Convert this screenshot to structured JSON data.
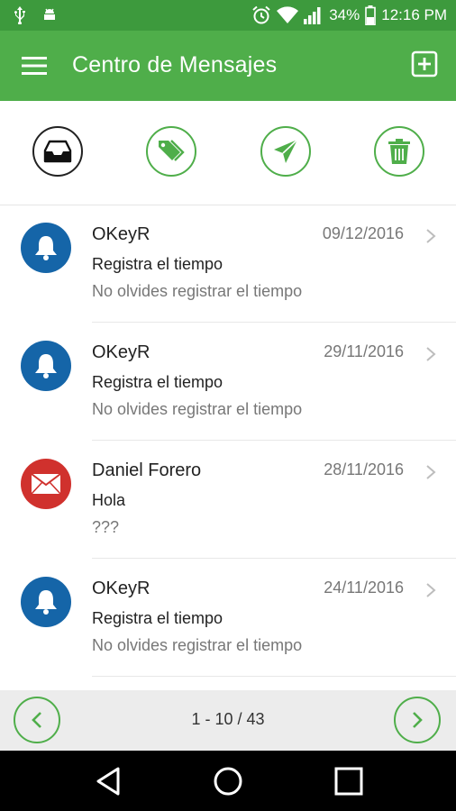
{
  "status_bar": {
    "battery": "34%",
    "time": "12:16 PM"
  },
  "app_bar": {
    "title": "Centro de Mensajes"
  },
  "messages": [
    {
      "sender": "OKeyR",
      "subject": "Registra el tiempo",
      "preview": "No olvides registrar el tiempo",
      "date": "09/12/2016",
      "type": "notification"
    },
    {
      "sender": "OKeyR",
      "subject": "Registra el tiempo",
      "preview": "No olvides registrar el tiempo",
      "date": "29/11/2016",
      "type": "notification"
    },
    {
      "sender": "Daniel Forero",
      "subject": "Hola",
      "preview": "???",
      "date": "28/11/2016",
      "type": "mail"
    },
    {
      "sender": "OKeyR",
      "subject": "Registra el tiempo",
      "preview": "No olvides registrar el tiempo",
      "date": "24/11/2016",
      "type": "notification"
    }
  ],
  "pagination": {
    "range": "1 - 10 / 43"
  },
  "colors": {
    "status_bar": "#3d9a3d",
    "app_bar": "#4fae4a",
    "accent_green": "#4fae4a",
    "notification_blue": "#1565a8",
    "mail_red": "#d0312d"
  }
}
